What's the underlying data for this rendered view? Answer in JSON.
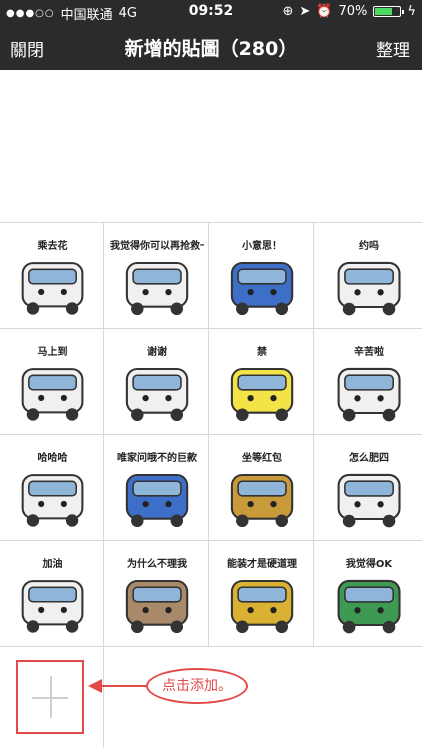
{
  "status_bar": {
    "carrier": "中国联通",
    "network": "4G",
    "time": "09:52",
    "battery": "70%",
    "battery_level": 0.7
  },
  "nav": {
    "close_label": "關閉",
    "title": "新增的貼圖（280）",
    "manage_label": "整理"
  },
  "stickers": [
    {
      "caption": "乘去花"
    },
    {
      "caption": "我觉得你可以再抢救一下"
    },
    {
      "caption": "小意思！"
    },
    {
      "caption": "约吗"
    },
    {
      "caption": "马上到"
    },
    {
      "caption": "谢谢"
    },
    {
      "caption": "禁"
    },
    {
      "caption": "辛苦啦"
    },
    {
      "caption": "哈哈哈"
    },
    {
      "caption": "唯家问哦不的巨款"
    },
    {
      "caption": "坐等红包"
    },
    {
      "caption": "怎么肥四"
    },
    {
      "caption": "加油"
    },
    {
      "caption": "为什么不理我"
    },
    {
      "caption": "能装才是硬道理"
    },
    {
      "caption": "我觉得OK"
    }
  ],
  "annotation": {
    "text": "点击添加。"
  },
  "colors": {
    "header_bg": "#2b2b2e",
    "annotation": "#e24a4a",
    "battery": "#4cd964"
  }
}
